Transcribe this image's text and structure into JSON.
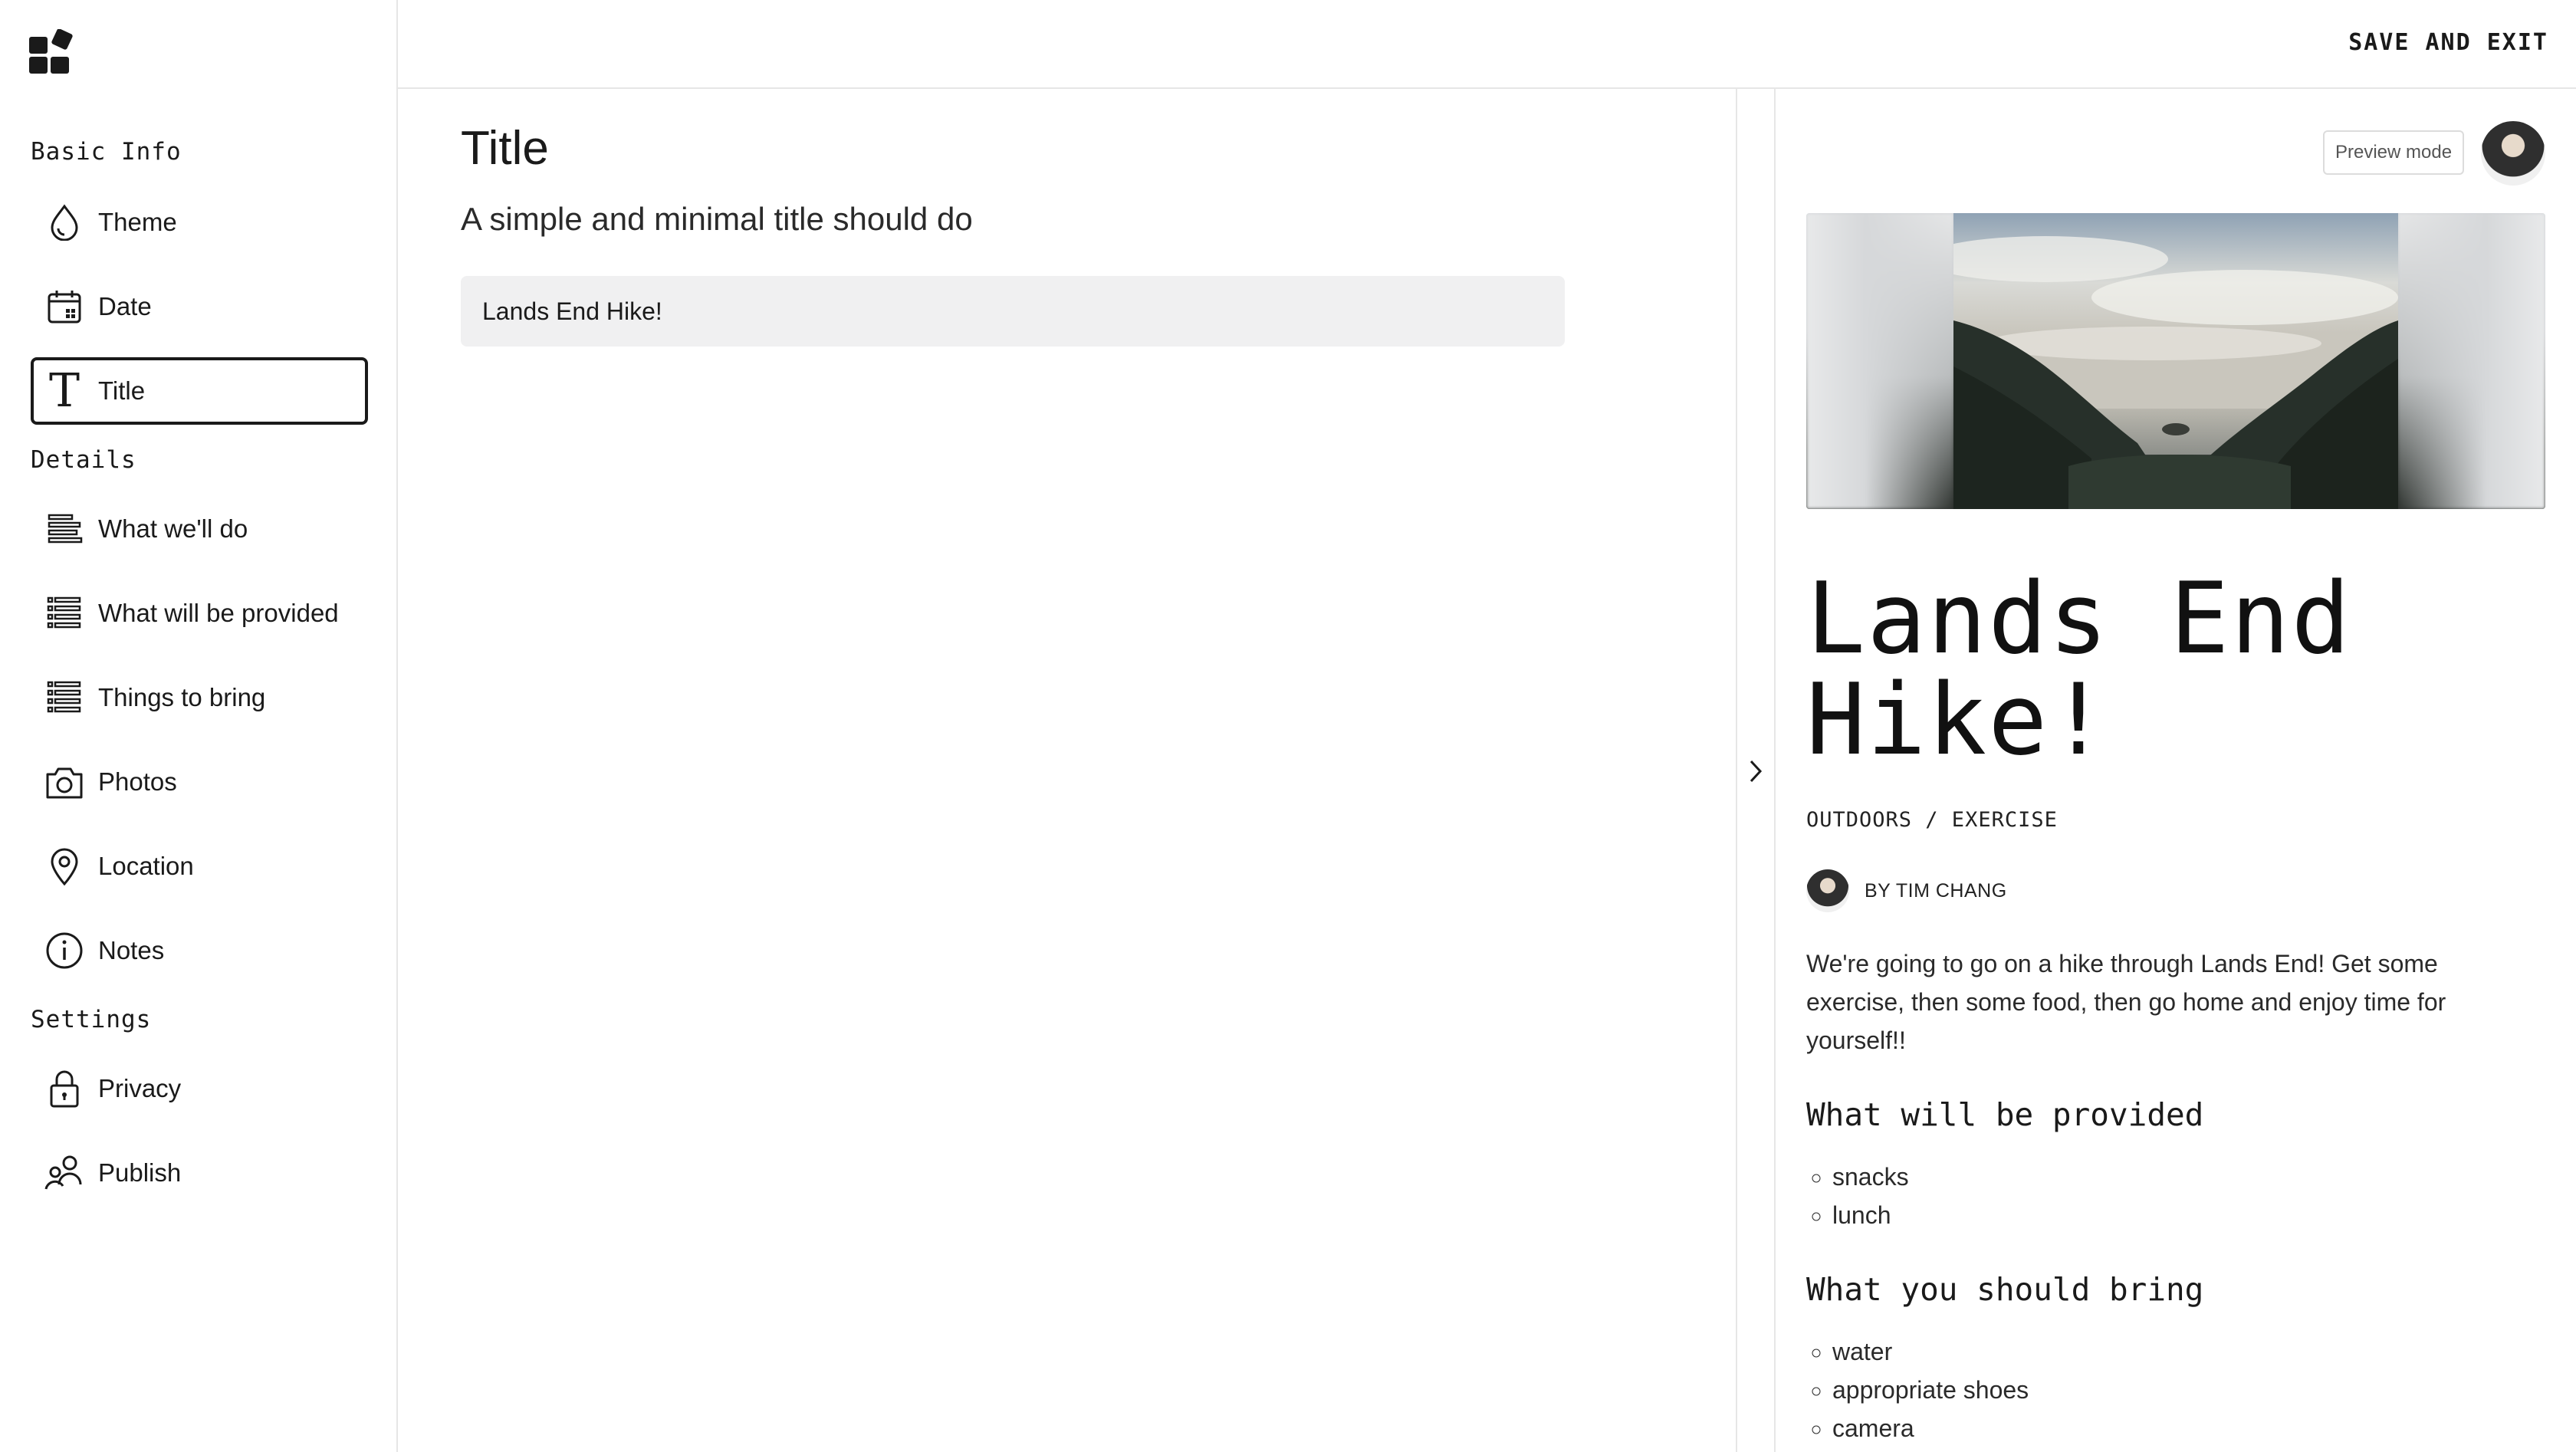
{
  "topbar": {
    "save_exit_label": "SAVE AND EXIT"
  },
  "sidebar": {
    "sections": {
      "basic_info": "Basic Info",
      "details": "Details",
      "settings": "Settings"
    },
    "items": [
      {
        "label": "Theme",
        "icon": "droplet-icon"
      },
      {
        "label": "Date",
        "icon": "calendar-icon"
      },
      {
        "label": "Title",
        "icon": "title-t-icon",
        "active": true
      },
      {
        "label": "What we'll do",
        "icon": "align-left-icon"
      },
      {
        "label": "What will be provided",
        "icon": "list-icon"
      },
      {
        "label": "Things to bring",
        "icon": "list-icon"
      },
      {
        "label": "Photos",
        "icon": "camera-icon"
      },
      {
        "label": "Location",
        "icon": "map-pin-icon"
      },
      {
        "label": "Notes",
        "icon": "info-icon"
      },
      {
        "label": "Privacy",
        "icon": "lock-icon"
      },
      {
        "label": "Publish",
        "icon": "people-icon"
      }
    ]
  },
  "editor": {
    "heading": "Title",
    "subheading": "A simple and minimal title should do",
    "title_value": "Lands End Hike!"
  },
  "preview": {
    "mode_label": "Preview mode",
    "title": "Lands End Hike!",
    "category": "OUTDOORS / EXERCISE",
    "author": "BY TIM CHANG",
    "description": "We're going to go on a hike through Lands End! Get some exercise, then some food, then go home and enjoy time for yourself!!",
    "provided_heading": "What will be provided",
    "provided_items": [
      "snacks",
      "lunch"
    ],
    "bring_heading": "What you should bring",
    "bring_items": [
      "water",
      "appropriate shoes",
      "camera"
    ]
  },
  "colors": {
    "text": "#1a1a1a",
    "border": "#e6e6e6",
    "input_bg": "#f0f0f1"
  }
}
